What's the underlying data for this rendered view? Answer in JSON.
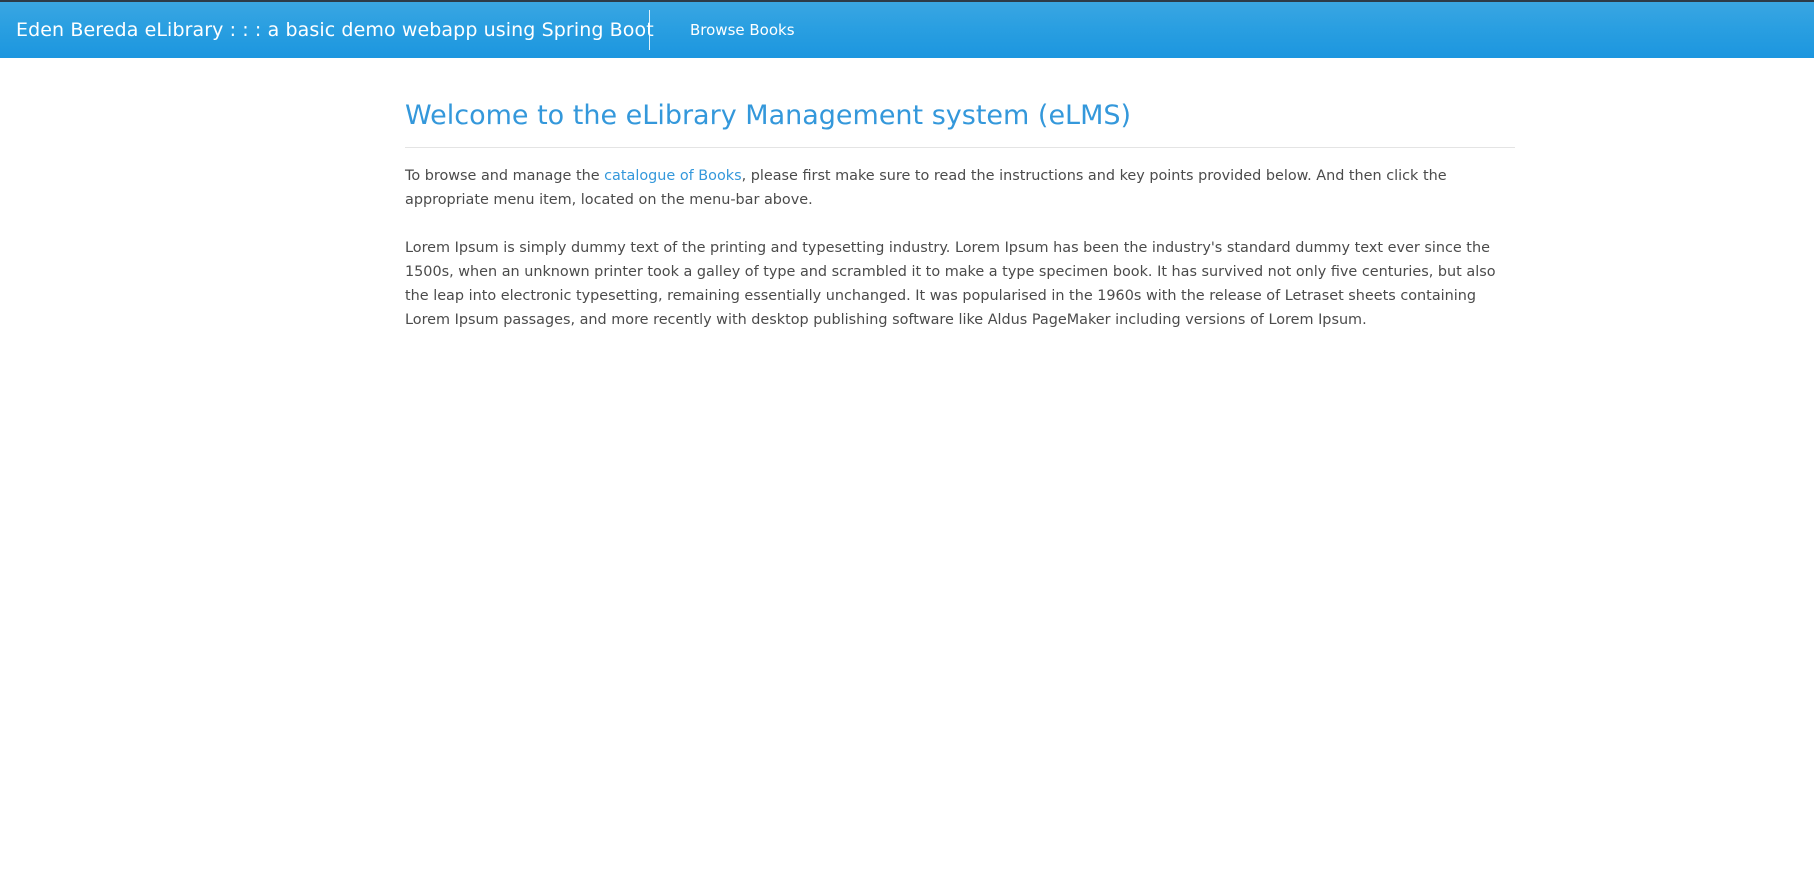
{
  "navbar": {
    "brand": "Eden Bereda eLibrary : : : a basic demo webapp using Spring Boot",
    "links": [
      {
        "label": "Browse Books"
      }
    ],
    "background_color": "#2a9fe1"
  },
  "main": {
    "title": "Welcome to the eLibrary Management system (eLMS)",
    "intro": {
      "text_before": "To browse and manage the ",
      "link_text": "catalogue of Books",
      "text_after": ", please first make sure to read the instructions and key points provided below. And then click the appropriate menu item, located on the menu-bar above."
    },
    "lorem": "Lorem Ipsum is simply dummy text of the printing and typesetting industry. Lorem Ipsum has been the industry's standard dummy text ever since the 1500s, when an unknown printer took a galley of type and scrambled it to make a type specimen book. It has survived not only five centuries, but also the leap into electronic typesetting, remaining essentially unchanged. It was popularised in the 1960s with the release of Letraset sheets containing Lorem Ipsum passages, and more recently with desktop publishing software like Aldus PageMaker including versions of Lorem Ipsum."
  },
  "colors": {
    "accent": "#3498db",
    "text": "#4b4b4b"
  }
}
